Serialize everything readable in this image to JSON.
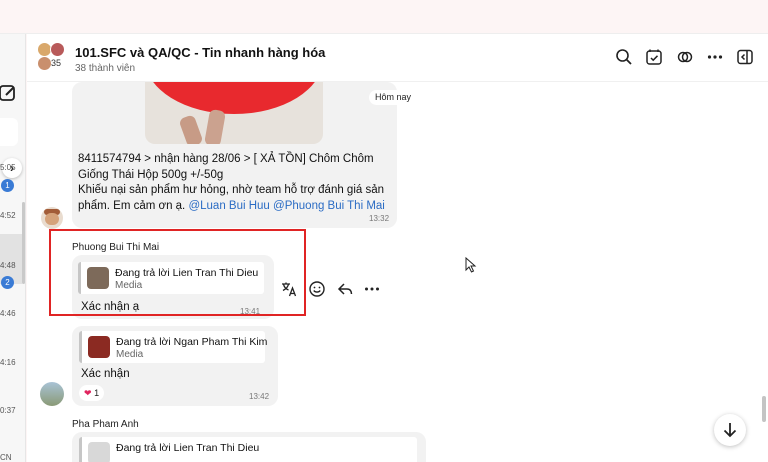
{
  "sidebar": {
    "times": [
      "5:05",
      "4:52",
      "4:48",
      "4:46",
      "4:16",
      "0:37",
      "CN"
    ],
    "badges": [
      "1",
      "2"
    ]
  },
  "header": {
    "title": "101.SFC và QA/QC - Tin nhanh hàng hóa",
    "members": "38 thành viên",
    "avatar_count": "35",
    "icons": [
      "search-icon",
      "calendar-check-icon",
      "chain-icon",
      "more-icon",
      "sidebar-toggle-icon"
    ]
  },
  "messages": {
    "today_label": "Hôm nay",
    "m1": {
      "line1": "8411574794 > nhận hàng 28/06 > [ XẢ TỒN] Chôm Chôm",
      "line2": "Giống Thái Hộp 500g +/-50g",
      "line3": "Khiếu nại sản phẩm hư hỏng, nhờ team hỗ trợ đánh giá sản",
      "line4_prefix": "phẩm. Em cảm ơn ạ. ",
      "mention1": "@Luan Bui Huu",
      "mention2": "@Phuong Bui Thi Mai",
      "time": "13:32"
    },
    "m2": {
      "sender": "Phuong Bui Thi Mai",
      "reply_title": "Đang trả lời Lien Tran Thi Dieu",
      "reply_sub": "Media",
      "text": "Xác nhận ạ",
      "time": "13:41"
    },
    "m3": {
      "reply_title": "Đang trả lời Ngan Pham Thi Kim",
      "reply_sub": "Media",
      "text": "Xác nhận",
      "reaction_count": "1",
      "time": "13:42"
    },
    "m4": {
      "sender": "Pha Pham Anh",
      "reply_title": "Đang trả lời Lien Tran Thi Dieu"
    }
  },
  "actions": [
    "translate-icon",
    "emoji-icon",
    "reply-icon",
    "more-actions-icon"
  ],
  "colors": {
    "highlight": "#e02424",
    "mention": "#2b6cc4",
    "badge": "#3a7bd5"
  }
}
